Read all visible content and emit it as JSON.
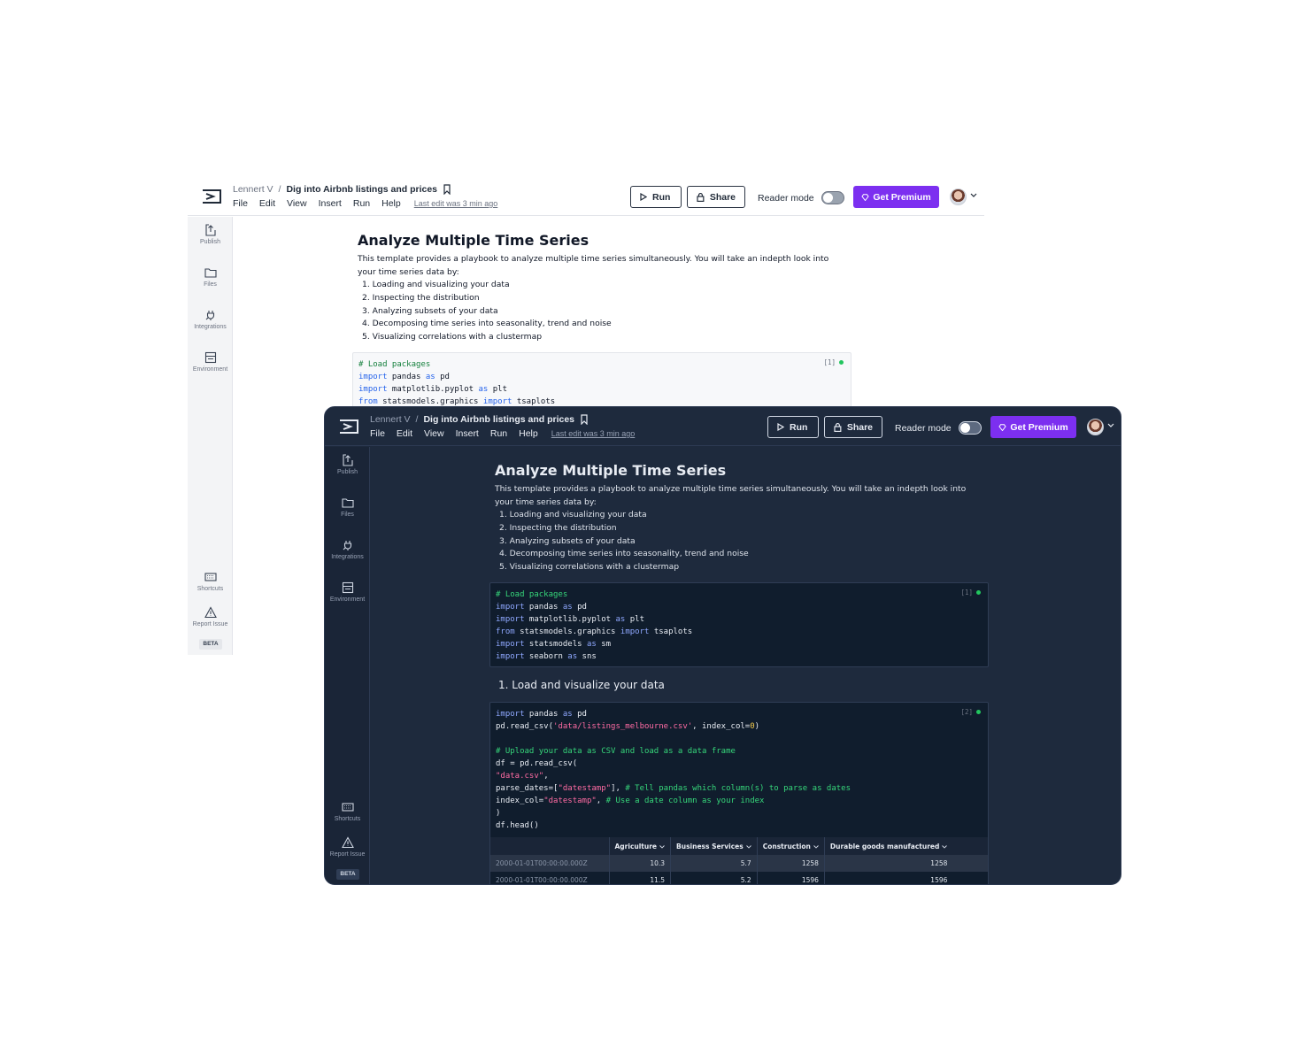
{
  "topbar": {
    "user": "Lennert V",
    "separator": "/",
    "notebook_title": "Dig into Airbnb listings and prices",
    "menu": [
      "File",
      "Edit",
      "View",
      "Insert",
      "Run",
      "Help"
    ],
    "last_edit": "Last edit was 3 min ago",
    "run_label": "Run",
    "share_label": "Share",
    "reader_mode_label": "Reader mode",
    "premium_label": "Get Premium"
  },
  "sidebar": {
    "top_items": [
      {
        "label": "Publish",
        "icon": "publish-icon"
      },
      {
        "label": "Files",
        "icon": "folder-icon"
      },
      {
        "label": "Integrations",
        "icon": "plug-icon"
      },
      {
        "label": "Environment",
        "icon": "environment-icon"
      }
    ],
    "bottom_items": [
      {
        "label": "Shortcuts",
        "icon": "keyboard-icon"
      },
      {
        "label": "Report Issue",
        "icon": "warning-icon"
      }
    ],
    "beta": "BETA"
  },
  "notebook": {
    "title": "Analyze Multiple Time Series",
    "intro": "This template provides a playbook to analyze multiple time series simultaneously. You will take an indepth look into your time series data by:",
    "steps": [
      "1. Loading and visualizing your data",
      "2. Inspecting the distribution",
      "3. Analyzing subsets of your data",
      "4. Decomposing time series into seasonality, trend and noise",
      "5. Visualizing correlations with a clustermap"
    ],
    "cell1_tag": "[1]",
    "cell2_tag": "[2]",
    "section_heading": "1. Load and visualize your data",
    "table": {
      "columns": [
        "Agriculture",
        "Business Services",
        "Construction",
        "Durable goods manufactured"
      ],
      "rows": [
        {
          "index": "2000-01-01T00:00:00.000Z",
          "values": [
            "10.3",
            "5.7",
            "1258",
            "1258"
          ]
        },
        {
          "index": "2000-01-01T00:00:00.000Z",
          "values": [
            "11.5",
            "5.2",
            "1596",
            "1596"
          ]
        }
      ]
    }
  },
  "colors": {
    "accent": "#7c2ff0",
    "dark_bg": "#1e2a3d",
    "status_green": "#22c55e"
  }
}
